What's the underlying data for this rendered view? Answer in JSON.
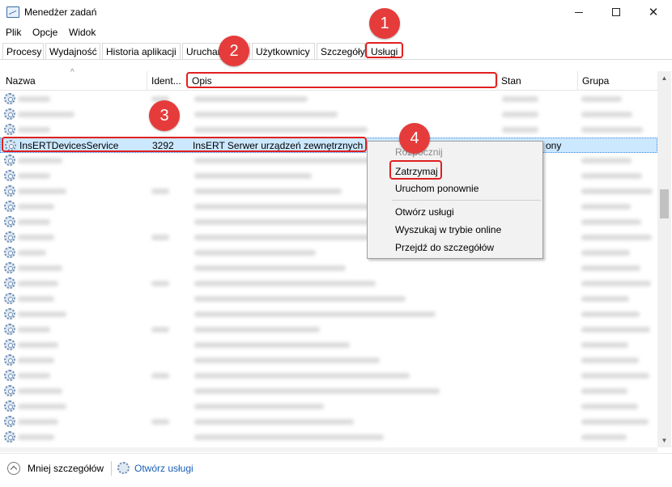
{
  "window": {
    "title": "Menedżer zadań",
    "minimize_glyph": "",
    "maximize_glyph": "",
    "close_glyph": "✕"
  },
  "menu": [
    {
      "label": "Plik"
    },
    {
      "label": "Opcje"
    },
    {
      "label": "Widok"
    }
  ],
  "tabs": [
    {
      "label": "Procesy"
    },
    {
      "label": "Wydajność"
    },
    {
      "label": "Historia aplikacji"
    },
    {
      "label": "Uruchamianie"
    },
    {
      "label": "Użytkownicy"
    },
    {
      "label": "Szczegóły"
    },
    {
      "label": "Usługi"
    }
  ],
  "columns": {
    "name": "Nazwa",
    "pid": "Ident...",
    "description": "Opis",
    "status": "Stan",
    "group": "Grupa"
  },
  "selected_service": {
    "name": "InsERTDevicesService",
    "pid": "3292",
    "description": "InsERT Serwer urządzeń zewnętrznych",
    "status_partial": "ony"
  },
  "context_menu": {
    "start": "Rozpocznij",
    "stop": "Zatrzymaj",
    "restart": "Uruchom ponownie",
    "open_services": "Otwórz usługi",
    "search_online": "Wyszukaj w trybie online",
    "go_to_details": "Przejdź do szczegółów"
  },
  "annotations": {
    "badge1": "1",
    "badge2": "2",
    "badge3": "3",
    "badge4": "4",
    "color": "#e02020"
  },
  "footer": {
    "less_details": "Mniej szczegółów",
    "open_services": "Otwórz usługi"
  },
  "icons": {
    "app": "task-manager-icon",
    "service": "gear-icon",
    "less": "chevron-up-circle-icon"
  }
}
